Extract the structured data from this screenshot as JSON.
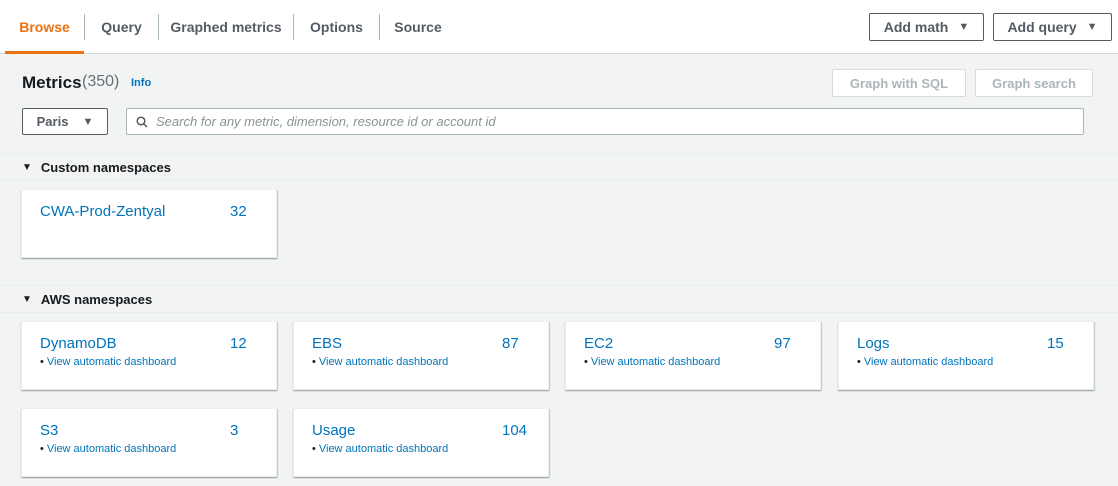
{
  "tabs": [
    {
      "label": "Browse",
      "active": true
    },
    {
      "label": "Query",
      "active": false
    },
    {
      "label": "Graphed metrics",
      "active": false
    },
    {
      "label": "Options",
      "active": false
    },
    {
      "label": "Source",
      "active": false
    }
  ],
  "toolbar": {
    "add_math": "Add math",
    "add_query": "Add query",
    "graph_sql": "Graph with SQL",
    "graph_search": "Graph search"
  },
  "header": {
    "title": "Metrics",
    "count": "(350)",
    "info": "Info"
  },
  "region": {
    "selected": "Paris"
  },
  "search": {
    "placeholder": "Search for any metric, dimension, resource id or account id",
    "value": ""
  },
  "custom_namespaces": {
    "heading": "Custom namespaces",
    "items": [
      {
        "name": "CWA-Prod-Zentyal",
        "count": "32"
      }
    ]
  },
  "aws_namespaces": {
    "heading": "AWS namespaces",
    "items": [
      {
        "name": "DynamoDB",
        "count": "12",
        "link": "View automatic dashboard"
      },
      {
        "name": "EBS",
        "count": "87",
        "link": "View automatic dashboard"
      },
      {
        "name": "EC2",
        "count": "97",
        "link": "View automatic dashboard"
      },
      {
        "name": "Logs",
        "count": "15",
        "link": "View automatic dashboard"
      },
      {
        "name": "S3",
        "count": "3",
        "link": "View automatic dashboard"
      },
      {
        "name": "Usage",
        "count": "104",
        "link": "View automatic dashboard"
      }
    ]
  },
  "colors": {
    "accent": "#ec7211",
    "link": "#0073bb",
    "text": "#16191f",
    "muted": "#545b64"
  },
  "icons": {
    "caret": "caret-down-icon",
    "expand": "triangle-down-icon",
    "search": "search-icon"
  }
}
